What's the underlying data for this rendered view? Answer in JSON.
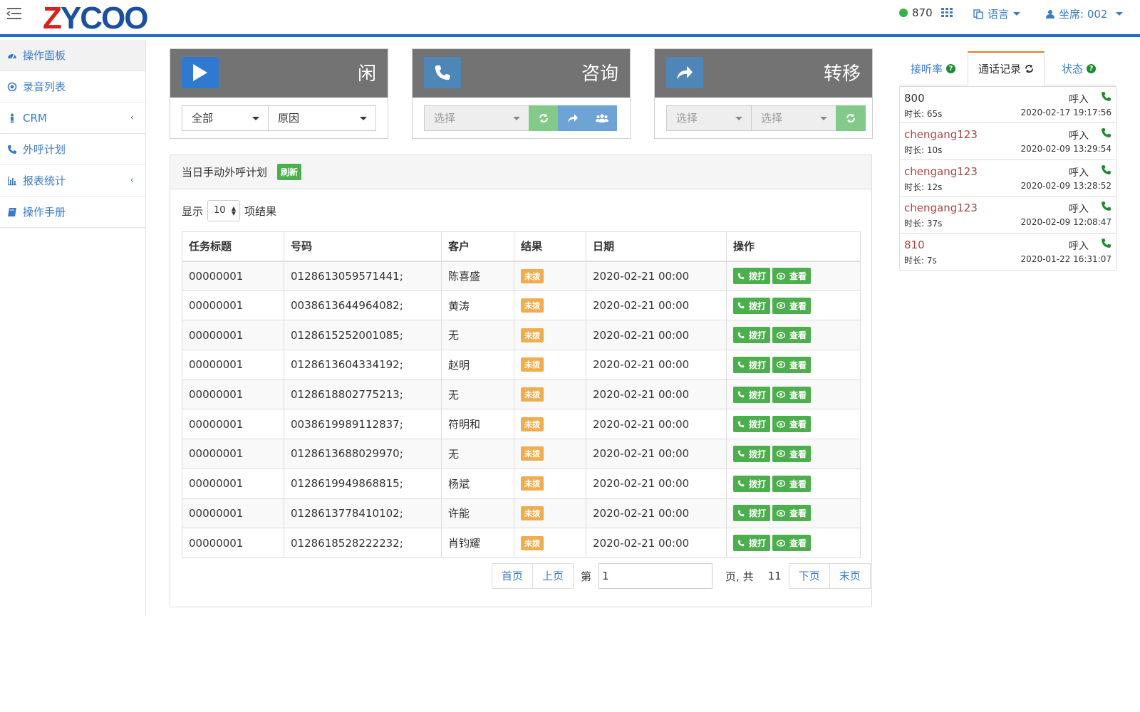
{
  "header": {
    "logo": "ZYCOO",
    "extension": "870",
    "language_label": "语言",
    "seat_label": "坐席: 002"
  },
  "sidebar": {
    "items": [
      {
        "label": "操作面板",
        "icon": "dashboard-icon"
      },
      {
        "label": "录音列表",
        "icon": "record-icon"
      },
      {
        "label": "CRM",
        "icon": "person-icon"
      },
      {
        "label": "外呼计划",
        "icon": "phone-icon"
      },
      {
        "label": "报表统计",
        "icon": "bar-chart-icon"
      },
      {
        "label": "操作手册",
        "icon": "book-icon"
      }
    ]
  },
  "panels": {
    "status": {
      "title": "闲",
      "select1": "全部",
      "select2": "原因"
    },
    "consult": {
      "title": "咨询",
      "select1": "选择"
    },
    "transfer": {
      "title": "转移",
      "select1": "选择",
      "select2": "选择"
    }
  },
  "plan": {
    "title": "当日手动外呼计划",
    "refresh_label": "刷新",
    "show_label": "显示",
    "page_length": "10",
    "results_label": "项结果",
    "columns": [
      "任务标题",
      "号码",
      "客户",
      "结果",
      "日期",
      "操作"
    ],
    "rows": [
      {
        "task": "00000001",
        "number": "0128613059571441;",
        "customer": "陈喜盛",
        "result": "未拨",
        "date": "2020-02-21 00:00"
      },
      {
        "task": "00000001",
        "number": "0038613644964082;",
        "customer": "黄涛",
        "result": "未拨",
        "date": "2020-02-21 00:00"
      },
      {
        "task": "00000001",
        "number": "0128615252001085;",
        "customer": "无",
        "result": "未拨",
        "date": "2020-02-21 00:00"
      },
      {
        "task": "00000001",
        "number": "0128613604334192;",
        "customer": "赵明",
        "result": "未拨",
        "date": "2020-02-21 00:00"
      },
      {
        "task": "00000001",
        "number": "0128618802775213;",
        "customer": "无",
        "result": "未拨",
        "date": "2020-02-21 00:00"
      },
      {
        "task": "00000001",
        "number": "0038619989112837;",
        "customer": "符明和",
        "result": "未拨",
        "date": "2020-02-21 00:00"
      },
      {
        "task": "00000001",
        "number": "0128613688029970;",
        "customer": "无",
        "result": "未拨",
        "date": "2020-02-21 00:00"
      },
      {
        "task": "00000001",
        "number": "0128619949868815;",
        "customer": "杨斌",
        "result": "未拨",
        "date": "2020-02-21 00:00"
      },
      {
        "task": "00000001",
        "number": "0128613778410102;",
        "customer": "许能",
        "result": "未拨",
        "date": "2020-02-21 00:00"
      },
      {
        "task": "00000001",
        "number": "0128618528222232;",
        "customer": "肖钧耀",
        "result": "未拨",
        "date": "2020-02-21 00:00"
      }
    ],
    "dial_label": "拨打",
    "view_label": "查看",
    "pager": {
      "first": "首页",
      "prev": "上页",
      "page_prefix": "第",
      "current_page": "1",
      "page_suffix": "页, 共",
      "total_pages": "11",
      "next": "下页",
      "last": "末页"
    }
  },
  "right_panel": {
    "tabs": [
      "接听率",
      "通话记录",
      "状态"
    ],
    "active_tab": "通话记录",
    "calls": [
      {
        "who": "800",
        "direction": "呼入",
        "duration": "时长: 65s",
        "time": "2020-02-17 19:17:56",
        "highlight": false
      },
      {
        "who": "chengang123",
        "direction": "呼入",
        "duration": "时长: 10s",
        "time": "2020-02-09 13:29:54",
        "highlight": true
      },
      {
        "who": "chengang123",
        "direction": "呼入",
        "duration": "时长: 12s",
        "time": "2020-02-09 13:28:52",
        "highlight": true
      },
      {
        "who": "chengang123",
        "direction": "呼入",
        "duration": "时长: 37s",
        "time": "2020-02-09 12:08:47",
        "highlight": true
      },
      {
        "who": "810",
        "direction": "呼入",
        "duration": "时长: 7s",
        "time": "2020-01-22 16:31:07",
        "highlight": true
      }
    ]
  },
  "colors": {
    "brand_blue": "#1b72c4",
    "link_blue": "#3a7bc8",
    "success_green": "#4cae4c",
    "warning_orange": "#f0ad4e",
    "panel_gray": "#737373"
  }
}
